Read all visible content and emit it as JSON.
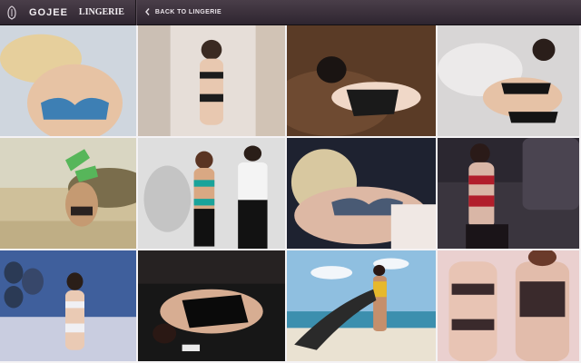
{
  "header": {
    "brand": "GOJEE",
    "section": "LINGERIE",
    "back_label": "BACK TO LINGERIE"
  },
  "icons": {
    "logo": "gojee-logo-icon",
    "back": "chevron-left-icon"
  },
  "gallery": {
    "tiles": [
      {
        "bg": "#cfd6de",
        "accent": "#3d7fb4",
        "skin": "#e7c3a4"
      },
      {
        "bg": "#e6ded8",
        "accent": "#1c1c1c",
        "skin": "#e8c8b0"
      },
      {
        "bg": "#5a3b26",
        "accent": "#1a1a1a",
        "skin": "#f0d8c8"
      },
      {
        "bg": "#d8d6d6",
        "accent": "#141414",
        "skin": "#e6c2a6"
      },
      {
        "bg": "#cfc09a",
        "accent": "#57b65a",
        "skin": "#c59a72"
      },
      {
        "bg": "#dedede",
        "accent": "#1aa39a",
        "skin": "#d9a883"
      },
      {
        "bg": "#1e2230",
        "accent": "#495a74",
        "skin": "#ddb8a4"
      },
      {
        "bg": "#2b2730",
        "accent": "#b11e2b",
        "skin": "#d9b6a6"
      },
      {
        "bg": "#3f5f9c",
        "accent": "#f0f0f4",
        "skin": "#eacab4"
      },
      {
        "bg": "#171717",
        "accent": "#0a0a0a",
        "skin": "#d7ad92"
      },
      {
        "bg": "#8fbfe0",
        "accent": "#2a2a2a",
        "skin": "#c58f6c"
      },
      {
        "bg": "#ead0cf",
        "accent": "#3a2a2c",
        "skin": "#e8c4b4"
      }
    ]
  }
}
